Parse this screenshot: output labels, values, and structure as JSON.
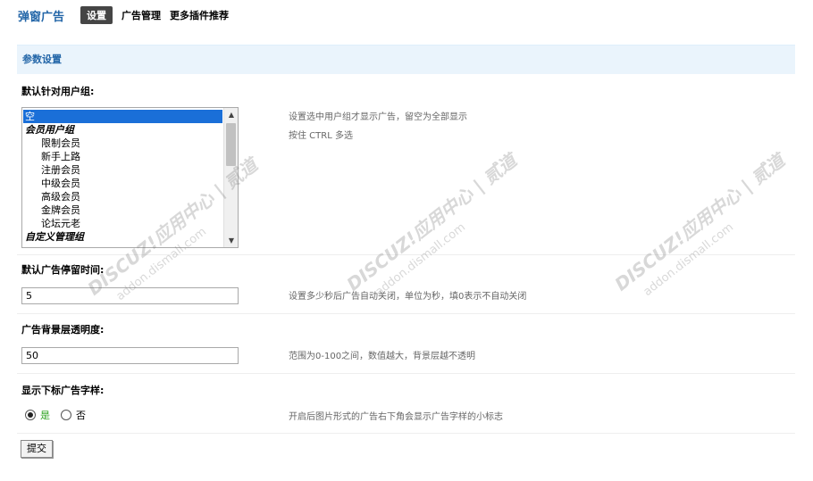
{
  "nav": {
    "plugin_title": "弹窗广告",
    "tabs": [
      {
        "label": "设置",
        "current": true
      },
      {
        "label": "广告管理",
        "current": false
      },
      {
        "label": "更多插件推荐",
        "current": false
      }
    ]
  },
  "section": {
    "title": "参数设置"
  },
  "user_groups": {
    "label": "默认针对用户组:",
    "options": [
      {
        "text": "空",
        "type": "option",
        "selected": true
      },
      {
        "text": "会员用户组",
        "type": "group"
      },
      {
        "text": "限制会员",
        "type": "child"
      },
      {
        "text": "新手上路",
        "type": "child"
      },
      {
        "text": "注册会员",
        "type": "child"
      },
      {
        "text": "中级会员",
        "type": "child"
      },
      {
        "text": "高级会员",
        "type": "child"
      },
      {
        "text": "金牌会员",
        "type": "child"
      },
      {
        "text": "论坛元老",
        "type": "child"
      },
      {
        "text": "自定义管理组",
        "type": "group"
      }
    ],
    "desc_line1": "设置选中用户组才显示广告，留空为全部显示",
    "desc_line2": "按住 CTRL 多选"
  },
  "stay_time": {
    "label": "默认广告停留时间:",
    "value": "5",
    "desc": "设置多少秒后广告自动关闭，单位为秒，填0表示不自动关闭"
  },
  "opacity": {
    "label": "广告背景层透明度:",
    "value": "50",
    "desc": "范围为0-100之间，数值越大，背景层越不透明"
  },
  "show_mark": {
    "label": "显示下标广告字样:",
    "yes_label": "是",
    "no_label": "否",
    "selected": "yes",
    "desc": "开启后图片形式的广告右下角会显示广告字样的小标志"
  },
  "submit": {
    "label": "提交"
  },
  "watermark": {
    "line1": "DISCUZ!应用中心 | 贰道",
    "line2": "addon.dismall.com"
  },
  "colors": {
    "accent": "#2366a8",
    "header_bg": "#eaf4fc",
    "selected_bg": "#1a6fd8",
    "yes_green": "#2aa21e"
  }
}
